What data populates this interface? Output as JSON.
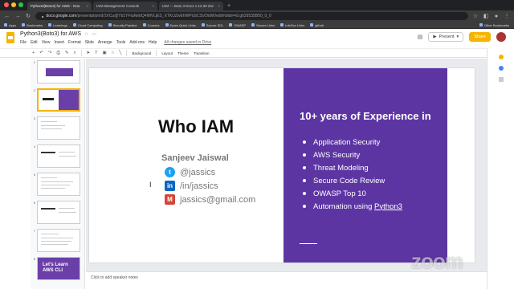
{
  "browser": {
    "tabs": [
      {
        "label": "Python3(Boto3) for AWS - Goo",
        "active": true
      },
      {
        "label": "IAM Management Console",
        "active": false
      },
      {
        "label": "IAM — Boto 3 Docs 1.12.30 doc",
        "active": false
      }
    ],
    "url_host": "docs.google.com",
    "url_path": "/presentation/d/1XCu@Yb1YFtaNebQ4lMVLjES_XTKUZwEhWPUbCSVDidW/edit#slide=id.g629535B50_0_0",
    "bookmarks": [
      "Apps",
      "Bookmarks",
      "Learnings",
      "Cloud Computing",
      "Security Practice",
      "Courses",
      "Epam Quick Links",
      "Secure SDL",
      "OWASP",
      "Secure Links",
      "InfoSec Links",
      "github"
    ],
    "other_bookmarks": "Other Bookmarks"
  },
  "doc": {
    "title": "Python3(Boto3) for AWS",
    "menus": [
      "File",
      "Edit",
      "View",
      "Insert",
      "Format",
      "Slide",
      "Arrange",
      "Tools",
      "Add-ons",
      "Help"
    ],
    "saved_status": "All changes saved in Drive",
    "present_label": "Present",
    "share_label": "Share"
  },
  "toolbar": {
    "background_label": "Background",
    "layout_label": "Layout",
    "theme_label": "Theme",
    "transition_label": "Transition"
  },
  "filmstrip": {
    "numbers": [
      "1",
      "2",
      "3",
      "4",
      "5",
      "6",
      "7",
      "8"
    ],
    "last_thumb_text": "Let's Learn AWS CLI"
  },
  "slide": {
    "title": "Who IAM",
    "name": "Sanjeev Jaiswal",
    "twitter": "@jassics",
    "linkedin": "/in/jassics",
    "email": "jassics@gmail.com",
    "experience_title": "10+ years of Experience in",
    "experience_items": [
      "Application Security",
      "AWS Security",
      "Threat Modeling",
      "Secure Code Review",
      "OWASP Top 10",
      "Automation using "
    ],
    "experience_link": "Python3"
  },
  "notes_placeholder": "Click to add speaker notes",
  "watermark": "zoom",
  "colors": {
    "purple": "#5d35a3",
    "share": "#f4b400",
    "twitter": "#1da1f2",
    "linkedin": "#0a66c2",
    "gmail": "#d44638"
  }
}
